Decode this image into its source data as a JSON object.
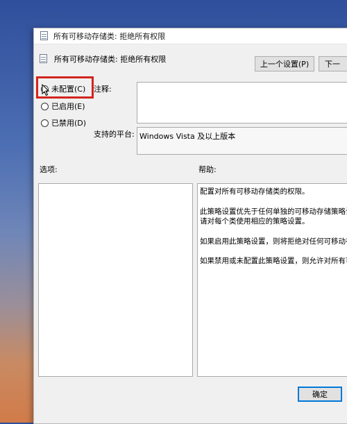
{
  "window": {
    "title": "所有可移动存储类: 拒绝所有权限"
  },
  "header": {
    "policy_name": "所有可移动存储类: 拒绝所有权限",
    "prev_button": "上一个设置(P)",
    "next_button": "下一"
  },
  "state": {
    "options": [
      {
        "label": "未配置(C)",
        "selected": true
      },
      {
        "label": "已启用(E)",
        "selected": false
      },
      {
        "label": "已禁用(D)",
        "selected": false
      }
    ]
  },
  "comment": {
    "label": "注释:",
    "value": ""
  },
  "platform": {
    "label": "支持的平台:",
    "value": "Windows Vista 及以上版本"
  },
  "options_panel": {
    "label": "选项:"
  },
  "help_panel": {
    "label": "帮助:",
    "lines": [
      "配置对所有可移动存储类的权限。",
      "",
      "此策略设置优先于任何单独的可移动存储策略设",
      "请对每个类使用相应的策略设置。",
      "",
      "如果启用此策略设置，则将拒绝对任何可移动存",
      "",
      "如果禁用或未配置此策略设置，则允许对所有可"
    ]
  },
  "footer": {
    "ok_button": "确定"
  }
}
